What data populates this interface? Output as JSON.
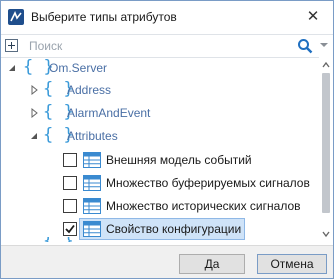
{
  "window": {
    "title": "Выберите типы атрибутов",
    "close_glyph": "✕",
    "icon": "app-logo-icon"
  },
  "search": {
    "placeholder": "Поиск",
    "value": ""
  },
  "tree": {
    "nodes": [
      {
        "label": "Om.Server",
        "icon": "braces-icon",
        "state": "expanded"
      },
      {
        "label": "Address",
        "icon": "braces-icon",
        "state": "collapsed"
      },
      {
        "label": "AlarmAndEvent",
        "icon": "braces-icon",
        "state": "collapsed"
      },
      {
        "label": "Attributes",
        "icon": "braces-icon",
        "state": "expanded"
      },
      {
        "label": "Внешняя модель событий",
        "icon": "table-icon",
        "checked": false
      },
      {
        "label": "Множество буферируемых сигналов",
        "icon": "table-icon",
        "checked": false
      },
      {
        "label": "Множество исторических сигналов",
        "icon": "table-icon",
        "checked": false
      },
      {
        "label": "Свойство конфигурации",
        "icon": "table-icon",
        "checked": true,
        "selected": true
      }
    ]
  },
  "footer": {
    "ok_label": "Да",
    "cancel_label": "Отмена"
  },
  "colors": {
    "accent_blue": "#3a9ad9",
    "selection": "#cfe3f8",
    "label_blue": "#4a6fa5"
  }
}
